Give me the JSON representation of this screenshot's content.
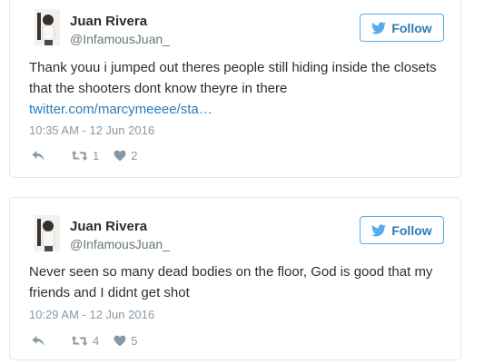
{
  "colors": {
    "accent": "#2b7bb9",
    "border": "#55acee",
    "muted": "#8899a6"
  },
  "tweets": [
    {
      "name": "Juan Rivera",
      "handle": "@InfamousJuan_",
      "follow_label": "Follow",
      "text": "Thank youu i jumped out theres people still hiding inside the closets that the shooters dont know theyre in there",
      "link": "twitter.com/marcymeeee/sta…",
      "timestamp": "10:35 AM - 12 Jun 2016",
      "retweets": "1",
      "likes": "2"
    },
    {
      "name": "Juan Rivera",
      "handle": "@InfamousJuan_",
      "follow_label": "Follow",
      "text": "Never seen so many dead bodies on the floor, God is good that my friends and I didnt get shot",
      "link": "",
      "timestamp": "10:29 AM - 12 Jun 2016",
      "retweets": "4",
      "likes": "5"
    }
  ]
}
